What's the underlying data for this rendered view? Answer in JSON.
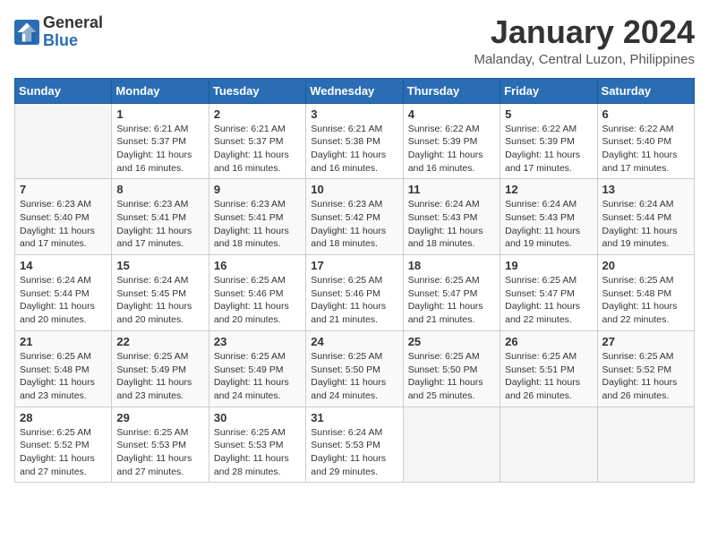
{
  "header": {
    "logo_general": "General",
    "logo_blue": "Blue",
    "title": "January 2024",
    "subtitle": "Malanday, Central Luzon, Philippines"
  },
  "weekdays": [
    "Sunday",
    "Monday",
    "Tuesday",
    "Wednesday",
    "Thursday",
    "Friday",
    "Saturday"
  ],
  "weeks": [
    [
      {
        "day": "",
        "info": ""
      },
      {
        "day": "1",
        "info": "Sunrise: 6:21 AM\nSunset: 5:37 PM\nDaylight: 11 hours\nand 16 minutes."
      },
      {
        "day": "2",
        "info": "Sunrise: 6:21 AM\nSunset: 5:37 PM\nDaylight: 11 hours\nand 16 minutes."
      },
      {
        "day": "3",
        "info": "Sunrise: 6:21 AM\nSunset: 5:38 PM\nDaylight: 11 hours\nand 16 minutes."
      },
      {
        "day": "4",
        "info": "Sunrise: 6:22 AM\nSunset: 5:39 PM\nDaylight: 11 hours\nand 16 minutes."
      },
      {
        "day": "5",
        "info": "Sunrise: 6:22 AM\nSunset: 5:39 PM\nDaylight: 11 hours\nand 17 minutes."
      },
      {
        "day": "6",
        "info": "Sunrise: 6:22 AM\nSunset: 5:40 PM\nDaylight: 11 hours\nand 17 minutes."
      }
    ],
    [
      {
        "day": "7",
        "info": "Sunrise: 6:23 AM\nSunset: 5:40 PM\nDaylight: 11 hours\nand 17 minutes."
      },
      {
        "day": "8",
        "info": "Sunrise: 6:23 AM\nSunset: 5:41 PM\nDaylight: 11 hours\nand 17 minutes."
      },
      {
        "day": "9",
        "info": "Sunrise: 6:23 AM\nSunset: 5:41 PM\nDaylight: 11 hours\nand 18 minutes."
      },
      {
        "day": "10",
        "info": "Sunrise: 6:23 AM\nSunset: 5:42 PM\nDaylight: 11 hours\nand 18 minutes."
      },
      {
        "day": "11",
        "info": "Sunrise: 6:24 AM\nSunset: 5:43 PM\nDaylight: 11 hours\nand 18 minutes."
      },
      {
        "day": "12",
        "info": "Sunrise: 6:24 AM\nSunset: 5:43 PM\nDaylight: 11 hours\nand 19 minutes."
      },
      {
        "day": "13",
        "info": "Sunrise: 6:24 AM\nSunset: 5:44 PM\nDaylight: 11 hours\nand 19 minutes."
      }
    ],
    [
      {
        "day": "14",
        "info": "Sunrise: 6:24 AM\nSunset: 5:44 PM\nDaylight: 11 hours\nand 20 minutes."
      },
      {
        "day": "15",
        "info": "Sunrise: 6:24 AM\nSunset: 5:45 PM\nDaylight: 11 hours\nand 20 minutes."
      },
      {
        "day": "16",
        "info": "Sunrise: 6:25 AM\nSunset: 5:46 PM\nDaylight: 11 hours\nand 20 minutes."
      },
      {
        "day": "17",
        "info": "Sunrise: 6:25 AM\nSunset: 5:46 PM\nDaylight: 11 hours\nand 21 minutes."
      },
      {
        "day": "18",
        "info": "Sunrise: 6:25 AM\nSunset: 5:47 PM\nDaylight: 11 hours\nand 21 minutes."
      },
      {
        "day": "19",
        "info": "Sunrise: 6:25 AM\nSunset: 5:47 PM\nDaylight: 11 hours\nand 22 minutes."
      },
      {
        "day": "20",
        "info": "Sunrise: 6:25 AM\nSunset: 5:48 PM\nDaylight: 11 hours\nand 22 minutes."
      }
    ],
    [
      {
        "day": "21",
        "info": "Sunrise: 6:25 AM\nSunset: 5:48 PM\nDaylight: 11 hours\nand 23 minutes."
      },
      {
        "day": "22",
        "info": "Sunrise: 6:25 AM\nSunset: 5:49 PM\nDaylight: 11 hours\nand 23 minutes."
      },
      {
        "day": "23",
        "info": "Sunrise: 6:25 AM\nSunset: 5:49 PM\nDaylight: 11 hours\nand 24 minutes."
      },
      {
        "day": "24",
        "info": "Sunrise: 6:25 AM\nSunset: 5:50 PM\nDaylight: 11 hours\nand 24 minutes."
      },
      {
        "day": "25",
        "info": "Sunrise: 6:25 AM\nSunset: 5:50 PM\nDaylight: 11 hours\nand 25 minutes."
      },
      {
        "day": "26",
        "info": "Sunrise: 6:25 AM\nSunset: 5:51 PM\nDaylight: 11 hours\nand 26 minutes."
      },
      {
        "day": "27",
        "info": "Sunrise: 6:25 AM\nSunset: 5:52 PM\nDaylight: 11 hours\nand 26 minutes."
      }
    ],
    [
      {
        "day": "28",
        "info": "Sunrise: 6:25 AM\nSunset: 5:52 PM\nDaylight: 11 hours\nand 27 minutes."
      },
      {
        "day": "29",
        "info": "Sunrise: 6:25 AM\nSunset: 5:53 PM\nDaylight: 11 hours\nand 27 minutes."
      },
      {
        "day": "30",
        "info": "Sunrise: 6:25 AM\nSunset: 5:53 PM\nDaylight: 11 hours\nand 28 minutes."
      },
      {
        "day": "31",
        "info": "Sunrise: 6:24 AM\nSunset: 5:53 PM\nDaylight: 11 hours\nand 29 minutes."
      },
      {
        "day": "",
        "info": ""
      },
      {
        "day": "",
        "info": ""
      },
      {
        "day": "",
        "info": ""
      }
    ]
  ]
}
